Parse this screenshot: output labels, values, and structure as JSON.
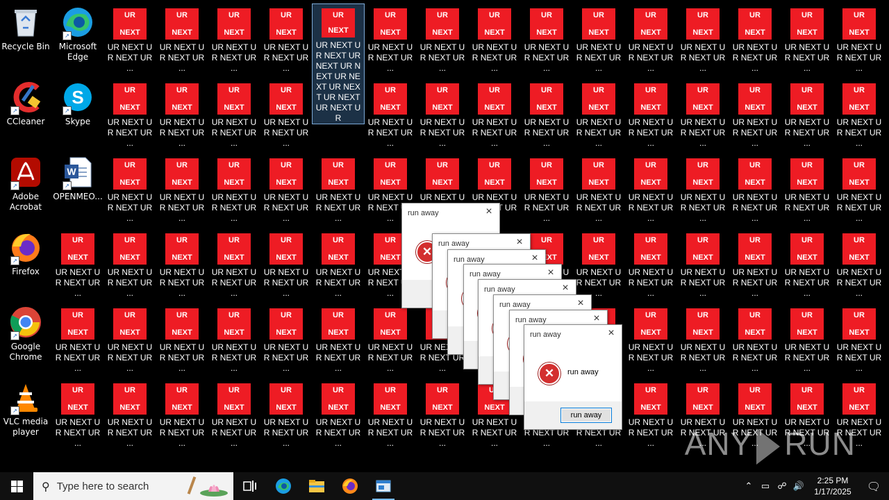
{
  "desktop": {
    "apps": [
      {
        "label": "Recycle Bin",
        "icon": "recycle-bin-icon"
      },
      {
        "label": "Microsoft Edge",
        "icon": "edge-icon"
      },
      {
        "label": "CCleaner",
        "icon": "ccleaner-icon"
      },
      {
        "label": "Skype",
        "icon": "skype-icon"
      },
      {
        "label": "Adobe Acrobat",
        "icon": "acrobat-icon"
      },
      {
        "label": "OPENMEO...",
        "icon": "word-doc-icon"
      },
      {
        "label": "Firefox",
        "icon": "firefox-icon"
      },
      {
        "label": "Google Chrome",
        "icon": "chrome-icon"
      },
      {
        "label": "VLC media player",
        "icon": "vlc-icon"
      }
    ],
    "ur_icon": {
      "tile_top": "UR",
      "tile_bottom": "NEXT",
      "label": "UR NEXT UR NEXT UR ...",
      "selected_label": "UR NEXT UR NEXT UR NEXT UR NEXT UR NEXT UR NEXT UR NEXT UR NEXT UR"
    }
  },
  "dialogs": {
    "title": "run away",
    "message": "run away",
    "button": "run away",
    "close": "×"
  },
  "watermark": {
    "left": "ANY",
    "right": "RUN"
  },
  "taskbar": {
    "search_placeholder": "Type here to search",
    "time": "2:25 PM",
    "date": "1/17/2025"
  },
  "colors": {
    "tile_red": "#ee1c24",
    "taskbar": "#101010",
    "accent": "#0078d7"
  }
}
